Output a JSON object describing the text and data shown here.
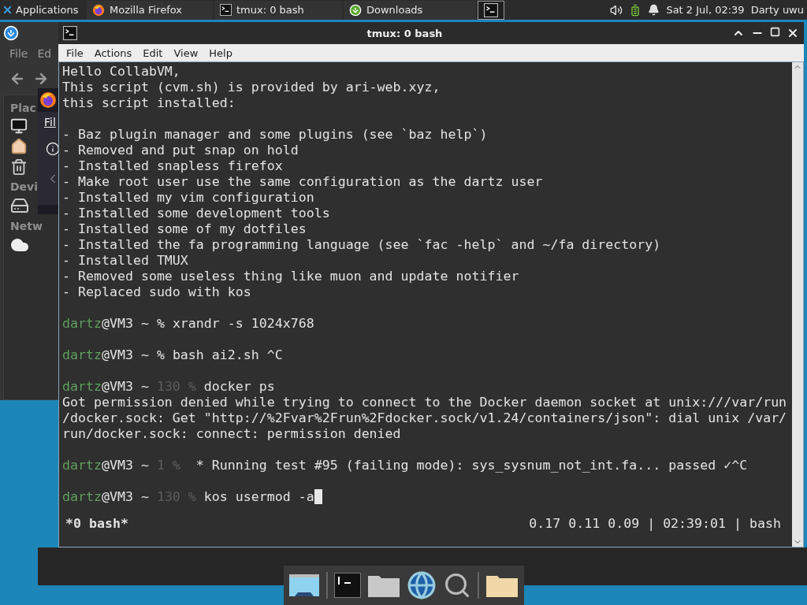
{
  "top_panel": {
    "applications": "Applications",
    "tasks": [
      {
        "label": "Mozilla Firefox",
        "selected": false
      },
      {
        "label": "tmux: 0 bash",
        "selected": false
      },
      {
        "label": "Downloads",
        "selected": false
      },
      {
        "selected": true
      }
    ],
    "clock": "Sat  2 Jul, 02:39",
    "user": "Darty uwu"
  },
  "file_manager": {
    "menu": [
      "File",
      "Ed"
    ],
    "sections": [
      "Plac",
      "Devi",
      "Netw"
    ]
  },
  "browser": {
    "menu": [
      "Fil"
    ]
  },
  "terminal": {
    "title": "tmux: 0 bash",
    "menu": [
      "File",
      "Actions",
      "Edit",
      "View",
      "Help"
    ],
    "lines": [
      {
        "kind": "text",
        "text": "Hello CollabVM,"
      },
      {
        "kind": "text",
        "text": "This script (cvm.sh) is provided by ari-web.xyz,"
      },
      {
        "kind": "text",
        "text": "this script installed:"
      },
      {
        "kind": "blank"
      },
      {
        "kind": "text",
        "text": "- Baz plugin manager and some plugins (see `baz help`)"
      },
      {
        "kind": "text",
        "text": "- Removed and put snap on hold"
      },
      {
        "kind": "text",
        "text": "- Installed snapless firefox"
      },
      {
        "kind": "text",
        "text": "- Make root user use the same configuration as the dartz user"
      },
      {
        "kind": "text",
        "text": "- Installed my vim configuration"
      },
      {
        "kind": "text",
        "text": "- Installed some development tools"
      },
      {
        "kind": "text",
        "text": "- Installed some of my dotfiles"
      },
      {
        "kind": "text",
        "text": "- Installed the fa programming language (see `fac -help` and ~/fa directory)"
      },
      {
        "kind": "text",
        "text": "- Installed TMUX"
      },
      {
        "kind": "text",
        "text": "- Removed some useless thing like muon and update notifier"
      },
      {
        "kind": "text",
        "text": "- Replaced sudo with kos"
      },
      {
        "kind": "blank"
      },
      {
        "kind": "prompt",
        "user": "dartz",
        "host": "@VM3 ~",
        "mark": "%",
        "command": "xrandr -s 1024x768",
        "cursor": false
      },
      {
        "kind": "blank"
      },
      {
        "kind": "prompt",
        "user": "dartz",
        "host": "@VM3 ~",
        "mark": "%",
        "command": "bash ai2.sh ^C",
        "cursor": false
      },
      {
        "kind": "blank"
      },
      {
        "kind": "prompt",
        "user": "dartz",
        "host": "@VM3 ~",
        "code": "130",
        "mark": "%",
        "command": "docker ps",
        "cursor": false
      },
      {
        "kind": "text",
        "text": "Got permission denied while trying to connect to the Docker daemon socket at unix:///var/run"
      },
      {
        "kind": "text",
        "text": "/docker.sock: Get \"http://%2Fvar%2Frun%2Fdocker.sock/v1.24/containers/json\": dial unix /var/"
      },
      {
        "kind": "text",
        "text": "run/docker.sock: connect: permission denied"
      },
      {
        "kind": "blank"
      },
      {
        "kind": "prompt",
        "user": "dartz",
        "host": "@VM3 ~",
        "code": "1",
        "mark": "%",
        "command": " * Running test #95 (failing mode): sys_sysnum_not_int.fa... passed ✓^C",
        "cursor": false
      },
      {
        "kind": "blank"
      },
      {
        "kind": "prompt",
        "user": "dartz",
        "host": "@VM3 ~",
        "code": "130",
        "mark": "%",
        "command": "kos usermod -a",
        "cursor": true
      }
    ],
    "status": {
      "left": "*0 bash*",
      "right": "0.17 0.11 0.09 | 02:39:01 | bash"
    }
  }
}
